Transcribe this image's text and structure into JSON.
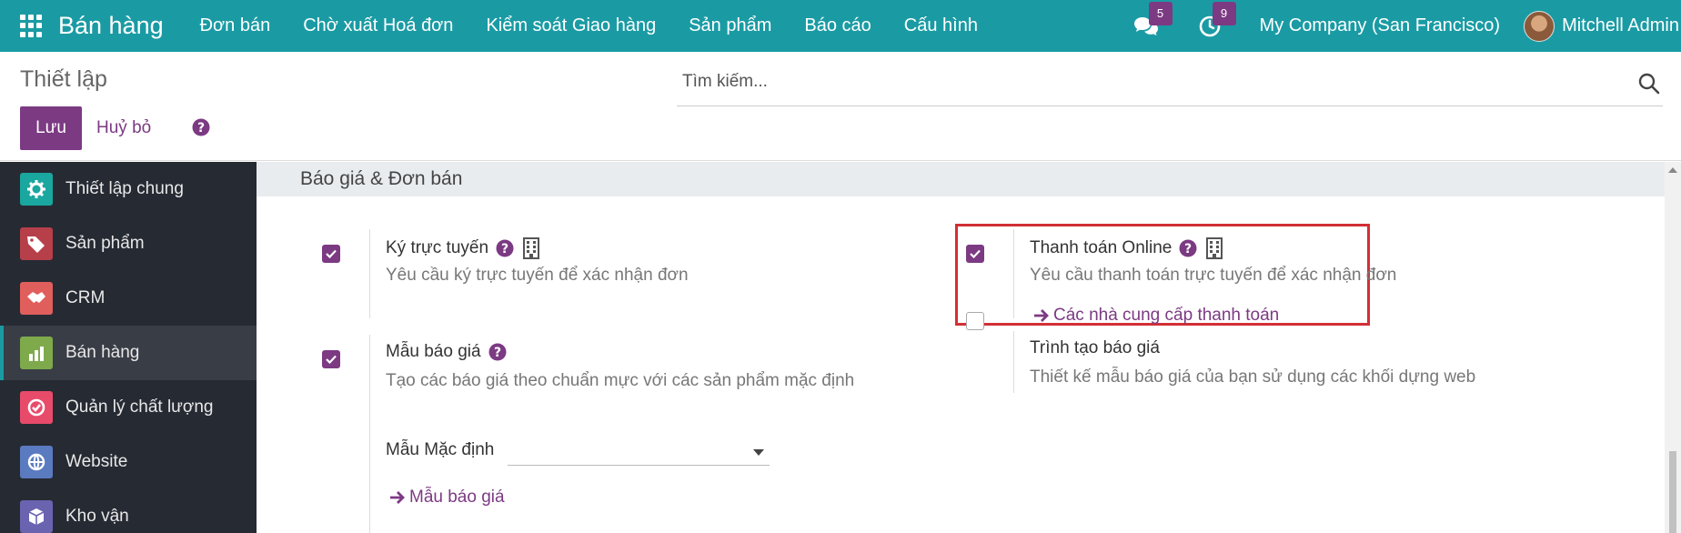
{
  "navbar": {
    "brand": "Bán hàng",
    "menu": [
      "Đơn bán",
      "Chờ xuất Hoá đơn",
      "Kiểm soát Giao hàng",
      "Sản phẩm",
      "Báo cáo",
      "Cấu hình"
    ],
    "messages_count": "5",
    "activities_count": "9",
    "company": "My Company (San Francisco)",
    "user": "Mitchell Admin"
  },
  "control": {
    "title": "Thiết lập",
    "search_placeholder": "Tìm kiếm...",
    "save_label": "Lưu",
    "cancel_label": "Huỷ bỏ"
  },
  "sidebar": {
    "items": [
      {
        "label": "Thiết lập chung",
        "icon": "gear-icon",
        "color": "#1aa7a0"
      },
      {
        "label": "Sản phẩm",
        "icon": "tag-icon",
        "color": "#b63f4a"
      },
      {
        "label": "CRM",
        "icon": "handshake-icon",
        "color": "#e05e5b"
      },
      {
        "label": "Bán hàng",
        "icon": "sales-chart-icon",
        "color": "#7eaa4c",
        "active": true
      },
      {
        "label": "Quản lý chất lượng",
        "icon": "quality-check-icon",
        "color": "#e84b6a"
      },
      {
        "label": "Website",
        "icon": "globe-icon",
        "color": "#5a7bbf"
      },
      {
        "label": "Kho vận",
        "icon": "box-icon",
        "color": "#6a63b0"
      }
    ]
  },
  "section": {
    "title": "Báo giá & Đơn bán"
  },
  "settings": {
    "online_signature": {
      "title": "Ký trực tuyến",
      "desc": "Yêu cầu ký trực tuyến để xác nhận đơn",
      "checked": true
    },
    "online_payment": {
      "title": "Thanh toán Online",
      "desc": "Yêu cầu thanh toán trực tuyến để xác nhận đơn",
      "link": "Các nhà cung cấp thanh toán",
      "checked": true
    },
    "quotation_templates": {
      "title": "Mẫu báo giá",
      "desc": "Tạo các báo giá theo chuẩn mực với các sản phẩm mặc định",
      "field_label": "Mẫu Mặc định",
      "field_value": "",
      "link": "Mẫu báo giá",
      "checked": true
    },
    "quotation_builder": {
      "title": "Trình tạo báo giá",
      "desc": "Thiết kế mẫu báo giá của bạn sử dụng các khối dựng web",
      "checked": false
    }
  },
  "colors": {
    "navbar": "#1a9ba4",
    "primary": "#7c3a83",
    "sidebar": "#262a33",
    "highlight": "#d22f35"
  }
}
